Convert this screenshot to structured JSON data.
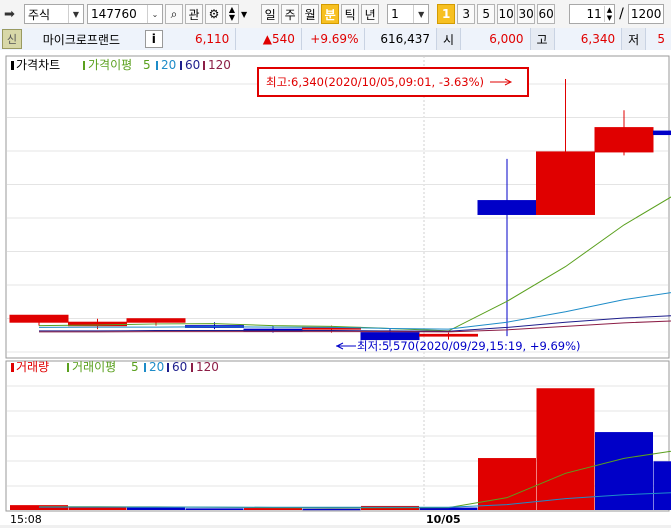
{
  "toolbar": {
    "market": "주식",
    "code": "147760",
    "watch_label": "관",
    "periods": [
      "일",
      "주",
      "월",
      "분",
      "틱",
      "년"
    ],
    "active_period": "분",
    "interval": "1",
    "minute_buttons": [
      "1",
      "3",
      "5",
      "10",
      "30",
      "60"
    ],
    "active_minute": "1",
    "count": "11",
    "slash": "/",
    "total": "1200"
  },
  "quote": {
    "credit_badge": "신",
    "name": "마이크로프랜드",
    "info": "i",
    "price": "6,110",
    "change": "▲540",
    "rate": "+9.69%",
    "volume": "616,437",
    "open_label": "시",
    "open": "6,000",
    "high_label": "고",
    "high": "6,340",
    "low_label": "저",
    "low": "5"
  },
  "price_panel": {
    "legend_title": "가격차트",
    "ma_label": "가격이평",
    "ma": [
      "5",
      "20",
      "60",
      "120"
    ],
    "high_annotation": "최고:6,340(2020/10/05,09:01, -3.63%)",
    "low_annotation": "최저:5,570(2020/09/29,15:19, +9.69%)"
  },
  "volume_panel": {
    "legend_title": "거래량",
    "ma_label": "거래이평",
    "ma": [
      "5",
      "20",
      "60",
      "120"
    ]
  },
  "x_axis": {
    "labels": [
      "15:08",
      "10/05"
    ]
  },
  "colors": {
    "up": "#e00000",
    "down": "#0000c8",
    "ma5": "#5aa01e",
    "ma20": "#1e8cc8",
    "ma60": "#1e1e8c",
    "ma120": "#8c1e46"
  },
  "chart_data": [
    {
      "type": "candlestick",
      "series": [
        {
          "open": 5640,
          "high": 5660,
          "low": 5630,
          "close": 5660
        },
        {
          "open": 5630,
          "high": 5650,
          "low": 5620,
          "close": 5640
        },
        {
          "open": 5640,
          "high": 5650,
          "low": 5630,
          "close": 5650
        },
        {
          "open": 5630,
          "high": 5640,
          "low": 5620,
          "close": 5625
        },
        {
          "open": 5620,
          "high": 5630,
          "low": 5610,
          "close": 5615
        },
        {
          "open": 5620,
          "high": 5630,
          "low": 5610,
          "close": 5625
        },
        {
          "open": 5610,
          "high": 5620,
          "low": 5570,
          "close": 5590
        },
        {
          "open": 5600,
          "high": 5610,
          "low": 5590,
          "close": 5605
        },
        {
          "open": 5990,
          "high": 6110,
          "low": 5600,
          "close": 5950
        },
        {
          "open": 5950,
          "high": 6340,
          "low": 5950,
          "close": 6130
        },
        {
          "open": 6130,
          "high": 6250,
          "low": 6120,
          "close": 6200
        },
        {
          "open": 6190,
          "high": 6270,
          "low": 6190,
          "close": 6180
        }
      ],
      "ma_lines": {
        "ma5": [
          5630,
          5632,
          5635,
          5636,
          5630,
          5628,
          5622,
          5615,
          5700,
          5800,
          5920,
          6020
        ],
        "ma20": [
          5625,
          5626,
          5626,
          5627,
          5626,
          5625,
          5622,
          5620,
          5640,
          5670,
          5705,
          5730
        ],
        "ma60": [
          5615,
          5615,
          5616,
          5616,
          5616,
          5616,
          5615,
          5614,
          5625,
          5640,
          5652,
          5660
        ],
        "ma120": [
          5612,
          5612,
          5613,
          5613,
          5613,
          5613,
          5613,
          5612,
          5618,
          5628,
          5638,
          5645
        ]
      },
      "ylim": [
        5560,
        6360
      ]
    },
    {
      "type": "bar",
      "values": [
        3000,
        2000,
        1500,
        1000,
        1200,
        800,
        2500,
        1500,
        32000,
        75000,
        48000,
        30000
      ],
      "colors": [
        "up",
        "up",
        "down",
        "down",
        "up",
        "down",
        "up",
        "down",
        "up",
        "up",
        "down",
        "down"
      ],
      "ma_lines": {
        "ma5": [
          2000,
          2000,
          1900,
          1700,
          1500,
          1300,
          1400,
          1500,
          7600,
          22600,
          31800,
          37300
        ],
        "ma20": [
          1800,
          1800,
          1800,
          1800,
          1700,
          1700,
          1700,
          1700,
          3300,
          7000,
          9400,
          10900
        ]
      },
      "ylim": [
        0,
        85000
      ]
    }
  ]
}
